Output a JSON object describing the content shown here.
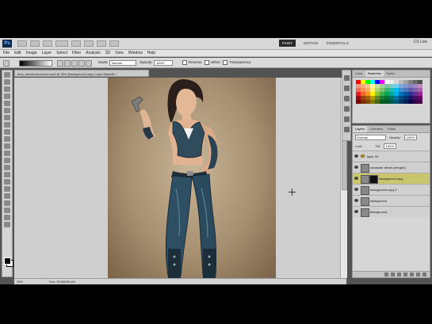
{
  "app": {
    "logo": "Ps",
    "live_label": "CS Live"
  },
  "workspaces": [
    {
      "label": "PAINT",
      "active": true
    },
    {
      "label": "MOTION",
      "active": false
    },
    {
      "label": "ESSENTIALS",
      "active": false
    }
  ],
  "menu": [
    "File",
    "Edit",
    "Image",
    "Layer",
    "Select",
    "Filter",
    "Analysis",
    "3D",
    "View",
    "Window",
    "Help"
  ],
  "options": {
    "mode_label": "Mode:",
    "mode_value": "Normal",
    "opacity_label": "Opacity:",
    "opacity_value": "100%",
    "reverse_label": "Reverse",
    "dither_label": "Dither",
    "transparency_label": "Transparency"
  },
  "document": {
    "tab_title": "lena_ambientocclusion.psd @ 33% (background copy, Layer Mask/8) *",
    "zoom": "33%",
    "doc_size": "Doc: 33.8M/95.4M"
  },
  "swatches_panel": {
    "tabs": [
      "Color",
      "Swatches",
      "Styles"
    ],
    "active": "Swatches"
  },
  "swatch_colors": [
    "#ff0000",
    "#ffff00",
    "#00ff00",
    "#00ffff",
    "#0000ff",
    "#ff00ff",
    "#ffffff",
    "#ebebeb",
    "#d4d4d4",
    "#bcbcbc",
    "#a0a0a0",
    "#848484",
    "#686868",
    "#4c4c4c",
    "#f7977a",
    "#f9ad81",
    "#fdc68a",
    "#fff79a",
    "#c4df9b",
    "#a2d39c",
    "#82ca9d",
    "#7bcdc8",
    "#6ecff6",
    "#7ea7d8",
    "#8493ca",
    "#8882be",
    "#a187be",
    "#bc8dbf",
    "#f26c4f",
    "#f68e55",
    "#fbaf5c",
    "#fff467",
    "#acd372",
    "#7cc576",
    "#3bb878",
    "#1abbb4",
    "#00bff3",
    "#438cca",
    "#5574b9",
    "#605ca8",
    "#855fa8",
    "#a763a8",
    "#ed1c24",
    "#f26522",
    "#f7941d",
    "#fff200",
    "#8dc73f",
    "#39b54a",
    "#00a651",
    "#00a99d",
    "#00aeef",
    "#0072bc",
    "#0054a6",
    "#2e3192",
    "#662d91",
    "#92278f",
    "#9e0b0f",
    "#a0410d",
    "#a36209",
    "#aba000",
    "#598527",
    "#197b30",
    "#007236",
    "#00746b",
    "#0076a3",
    "#004b80",
    "#003471",
    "#1b1464",
    "#440e62",
    "#630460",
    "#790000",
    "#7b2e00",
    "#7d4900",
    "#827b00",
    "#406618",
    "#005e20",
    "#005826",
    "#005952",
    "#005b7f",
    "#003663",
    "#002157",
    "#0d004c",
    "#32004b",
    "#4b0049"
  ],
  "layers_panel": {
    "tabs": [
      "Layers",
      "Channels",
      "Paths"
    ],
    "active": "Layers",
    "blend_mode": "Overlay",
    "opacity_label": "Opacity:",
    "opacity_value": "100%",
    "lock_label": "Lock:",
    "fill_label": "Fill:",
    "fill_value": "100%",
    "layers": [
      {
        "name": "layer 09",
        "kind": "group",
        "active": false
      },
      {
        "name": "character detail (merged)",
        "kind": "normal",
        "active": false
      },
      {
        "name": "background copy",
        "kind": "masked",
        "active": true
      },
      {
        "name": "background copy 2",
        "kind": "normal",
        "active": false
      },
      {
        "name": "background",
        "kind": "normal",
        "active": false
      },
      {
        "name": "Background",
        "kind": "normal",
        "active": false
      }
    ]
  }
}
